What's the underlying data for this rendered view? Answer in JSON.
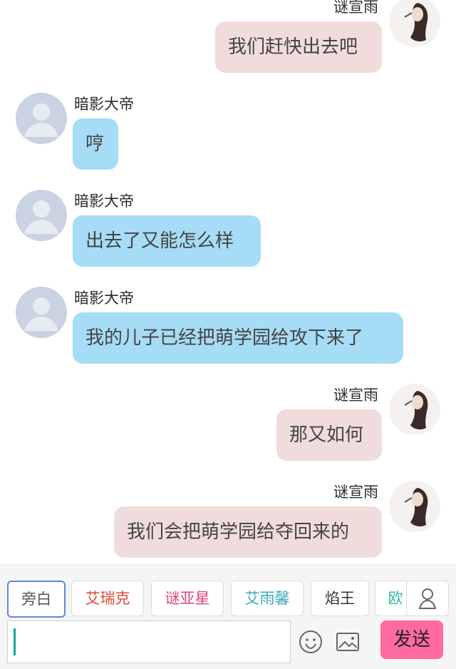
{
  "messages": [
    {
      "side": "right",
      "sender": "谜宣雨",
      "text": "我们赶快出去吧"
    },
    {
      "side": "left",
      "sender": "暗影大帝",
      "text": "哼"
    },
    {
      "side": "left",
      "sender": "暗影大帝",
      "text": "出去了又能怎么样"
    },
    {
      "side": "left",
      "sender": "暗影大帝",
      "text": "我的儿子已经把萌学园给攻下来了"
    },
    {
      "side": "right",
      "sender": "谜宣雨",
      "text": "那又如何"
    },
    {
      "side": "right",
      "sender": "谜宣雨",
      "text": "我们会把萌学园给夺回来的"
    }
  ],
  "roles": [
    {
      "label": "旁白",
      "color": "#555555"
    },
    {
      "label": "艾瑞克",
      "color": "#e0483a"
    },
    {
      "label": "谜亚星",
      "color": "#e0447e"
    },
    {
      "label": "艾雨馨",
      "color": "#3aa8b8"
    },
    {
      "label": "焰王",
      "color": "#333333"
    },
    {
      "label": "欧",
      "color": "#33b8a8"
    }
  ],
  "input": {
    "value": ""
  },
  "send_label": "发送",
  "icons": {
    "emoji": "smiley-icon",
    "image": "image-icon",
    "profile": "person-icon"
  }
}
